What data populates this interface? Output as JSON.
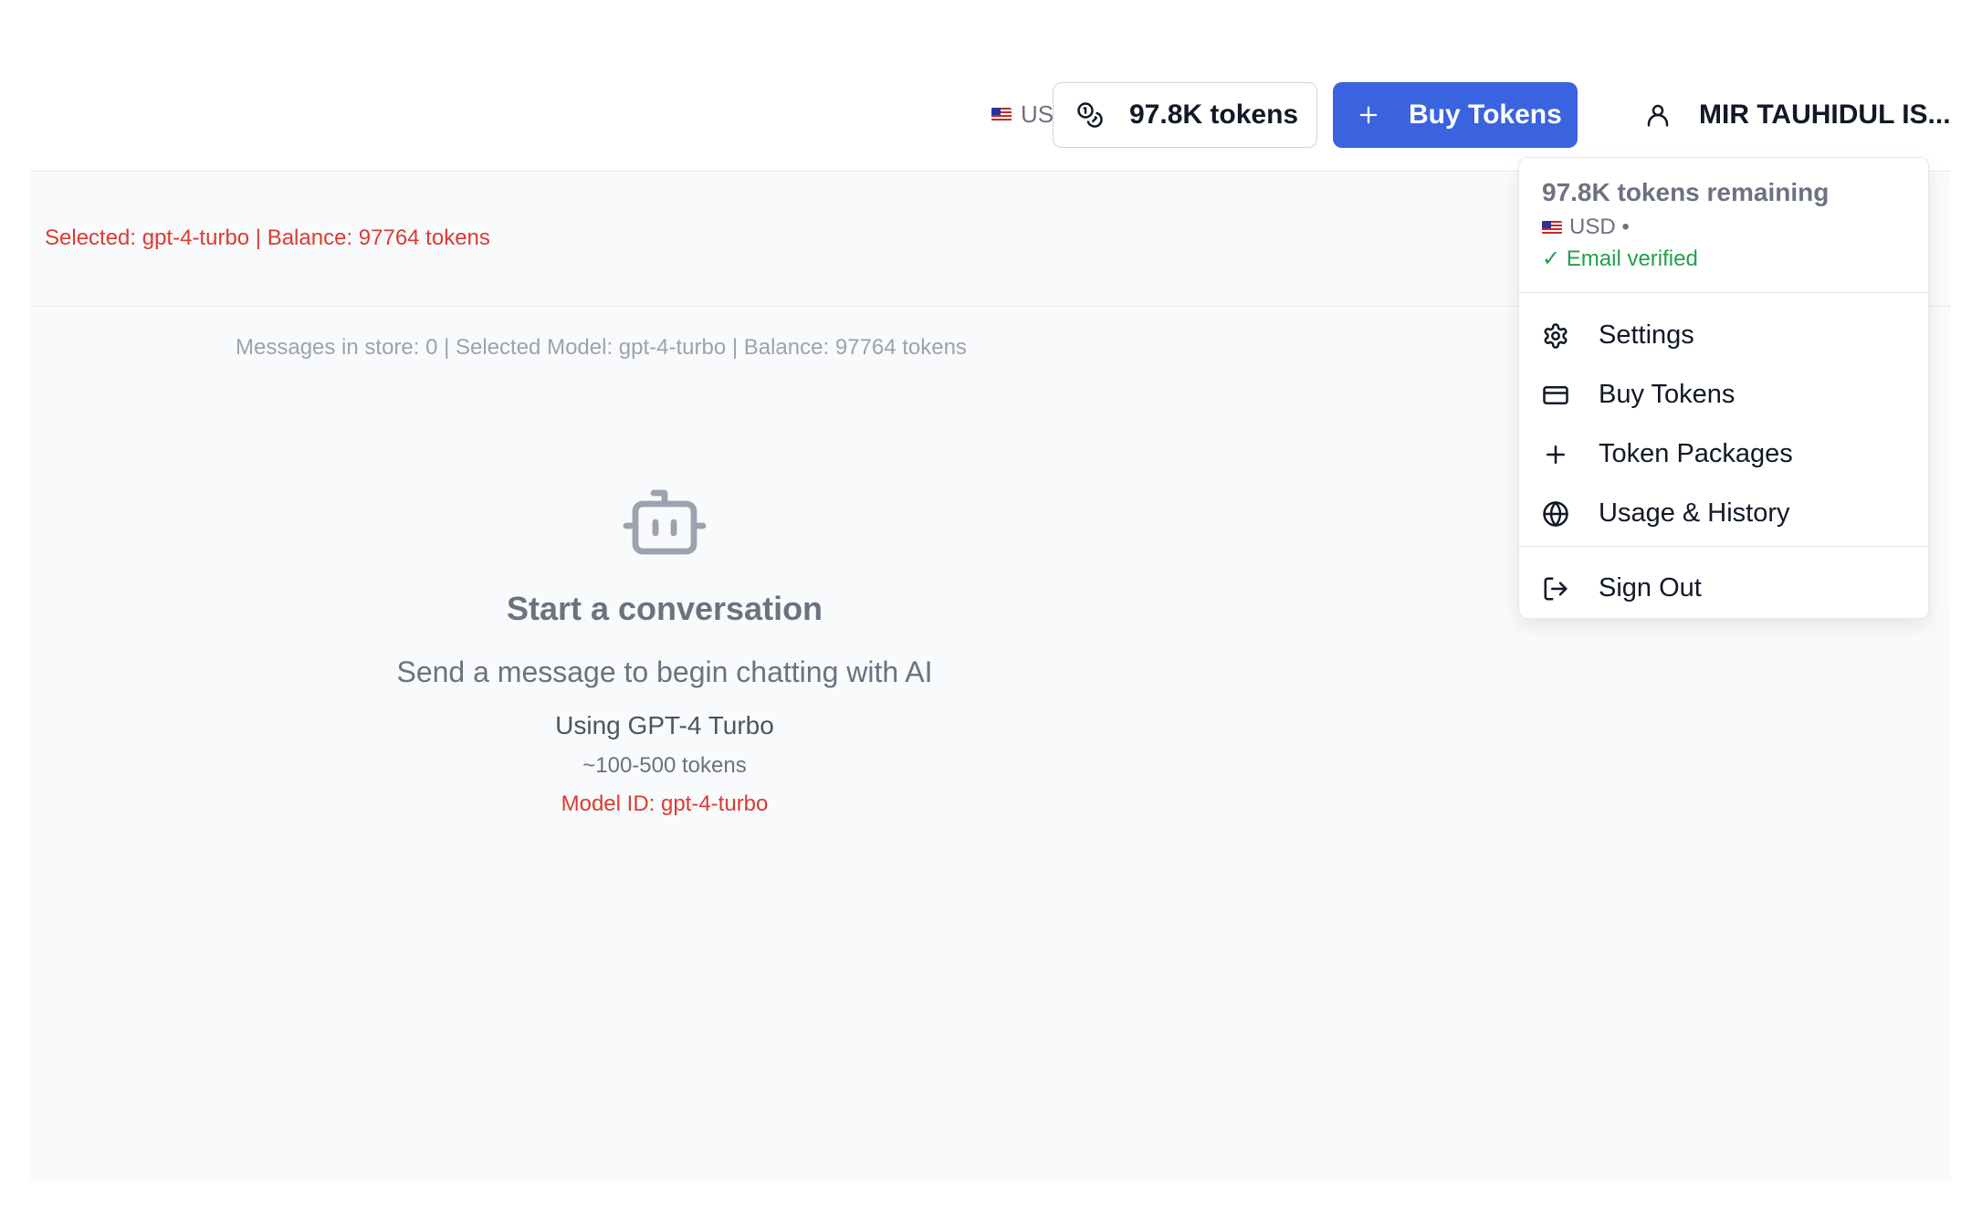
{
  "header": {
    "currency": "USD",
    "token_balance": "97.8K tokens",
    "buy_label": "Buy Tokens",
    "user_name": "MIR TAUHIDUL IS..."
  },
  "status": {
    "selected_line": "Selected: gpt-4-turbo | Balance: 97764 tokens",
    "store_line": "Messages in store: 0 | Selected Model: gpt-4-turbo | Balance: 97764 tokens"
  },
  "empty_state": {
    "icon": "bot-icon",
    "title": "Start a conversation",
    "subtitle": "Send a message to begin chatting with AI",
    "model": "Using GPT-4 Turbo",
    "estimate": "~100-500 tokens",
    "model_id": "Model ID: gpt-4-turbo"
  },
  "user_menu": {
    "tokens_remaining": "97.8K tokens remaining",
    "currency": "USD •",
    "email_status": "✓ Email verified",
    "items": [
      {
        "label": "Settings",
        "icon": "gear-icon"
      },
      {
        "label": "Buy Tokens",
        "icon": "credit-card-icon"
      },
      {
        "label": "Token Packages",
        "icon": "plus-icon"
      },
      {
        "label": "Usage & History",
        "icon": "globe-icon"
      }
    ],
    "sign_out": "Sign Out"
  },
  "colors": {
    "primary": "#3b63e0",
    "error_text": "#dc3b31",
    "success_text": "#22a04b",
    "muted": "#6b7280"
  }
}
